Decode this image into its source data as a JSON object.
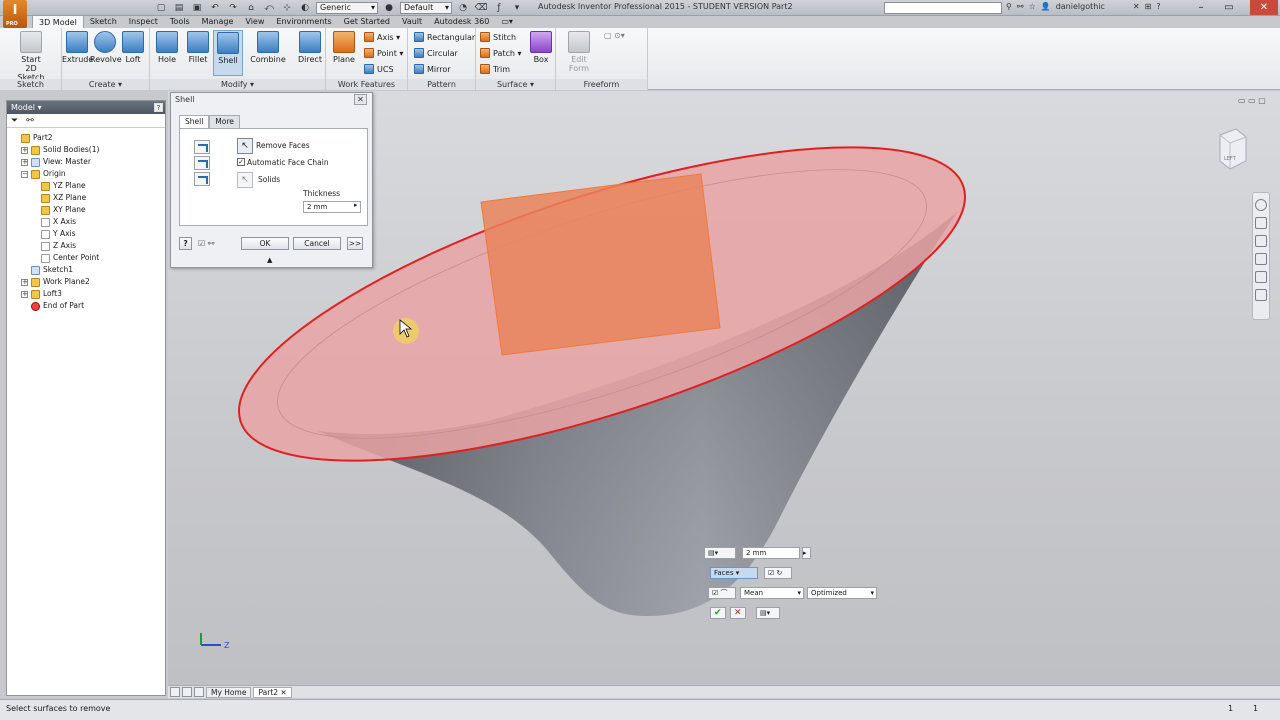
{
  "app": {
    "icon_text": "I",
    "icon_sub": "PRO",
    "title": "Autodesk Inventor Professional 2015 - STUDENT VERSION    Part2",
    "material_select": "Generic",
    "appearance_select": "Default",
    "user": "danielgothic",
    "quick_access": [
      "new-icon",
      "open-icon",
      "save-icon",
      "undo-icon",
      "redo-icon",
      "home-icon",
      "return-icon",
      "select-icon"
    ]
  },
  "menu_tabs": [
    "3D Model",
    "Sketch",
    "Inspect",
    "Tools",
    "Manage",
    "View",
    "Environments",
    "Get Started",
    "Vault",
    "Autodesk 360"
  ],
  "ribbon": {
    "sketch": {
      "title": "Sketch",
      "start_label_1": "Start",
      "start_label_2": "2D Sketch"
    },
    "create": {
      "title": "Create ▾",
      "extrude": "Extrude",
      "revolve": "Revolve",
      "loft": "Loft"
    },
    "modify": {
      "title": "Modify ▾",
      "hole": "Hole",
      "fillet": "Fillet",
      "shell": "Shell",
      "combine": "Combine",
      "direct": "Direct"
    },
    "work_features": {
      "title": "Work Features",
      "plane": "Plane",
      "axis": "Axis ▾",
      "point": "Point ▾",
      "ucs": "UCS"
    },
    "pattern": {
      "title": "Pattern",
      "rectangular": "Rectangular",
      "circular": "Circular",
      "mirror": "Mirror"
    },
    "surface": {
      "title": "Surface ▾",
      "stitch": "Stitch",
      "patch": "Patch ▾",
      "trim": "Trim",
      "box": "Box"
    },
    "freeform": {
      "title": "Freeform",
      "edit_form_1": "Edit",
      "edit_form_2": "Form"
    }
  },
  "browser": {
    "title": "Model ▾",
    "help": "?",
    "tree": [
      {
        "label": "Part2",
        "indent": 0,
        "pm": "",
        "icon": "y"
      },
      {
        "label": "Solid Bodies(1)",
        "indent": 1,
        "pm": "+",
        "icon": "y"
      },
      {
        "label": "View: Master",
        "indent": 1,
        "pm": "+",
        "icon": "s"
      },
      {
        "label": "Origin",
        "indent": 1,
        "pm": "−",
        "icon": "y"
      },
      {
        "label": "YZ Plane",
        "indent": 2,
        "pm": "",
        "icon": "y"
      },
      {
        "label": "XZ Plane",
        "indent": 2,
        "pm": "",
        "icon": "y"
      },
      {
        "label": "XY Plane",
        "indent": 2,
        "pm": "",
        "icon": "y"
      },
      {
        "label": "X Axis",
        "indent": 2,
        "pm": "",
        "icon": "w"
      },
      {
        "label": "Y Axis",
        "indent": 2,
        "pm": "",
        "icon": "w"
      },
      {
        "label": "Z Axis",
        "indent": 2,
        "pm": "",
        "icon": "w"
      },
      {
        "label": "Center Point",
        "indent": 2,
        "pm": "",
        "icon": "w"
      },
      {
        "label": "Sketch1",
        "indent": 1,
        "pm": "",
        "icon": "s"
      },
      {
        "label": "Work Plane2",
        "indent": 1,
        "pm": "+",
        "icon": "y"
      },
      {
        "label": "Loft3",
        "indent": 1,
        "pm": "+",
        "icon": "y"
      },
      {
        "label": "End of Part",
        "indent": 1,
        "pm": "",
        "icon": "r"
      }
    ]
  },
  "shell_dialog": {
    "title": "Shell",
    "close": "✕",
    "tabs": [
      "Shell",
      "More"
    ],
    "remove_faces": "Remove Faces",
    "automatic_face_chain": "Automatic Face Chain",
    "automatic_face_chain_checked": true,
    "solids": "Solids",
    "thickness_label": "Thickness",
    "thickness_value": "2 mm",
    "ok": "OK",
    "cancel": "Cancel",
    "more": ">>",
    "help": "?"
  },
  "mini_toolbar": {
    "thickness_value": "2 mm",
    "faces": "Faces",
    "method": "Mean",
    "quality": "Optimized"
  },
  "viewcube": {
    "face_label": "LEFT"
  },
  "axis_label": "Z",
  "doc_tabs": [
    "My Home",
    "Part2"
  ],
  "status": {
    "message": "Select surfaces to remove",
    "count1": "1",
    "count2": "1"
  },
  "colors": {
    "accent": "#2b69ad",
    "selection_edge": "#e02020",
    "selected_face_fill": "#e8a0a0",
    "highlight_face": "#e9845c"
  }
}
